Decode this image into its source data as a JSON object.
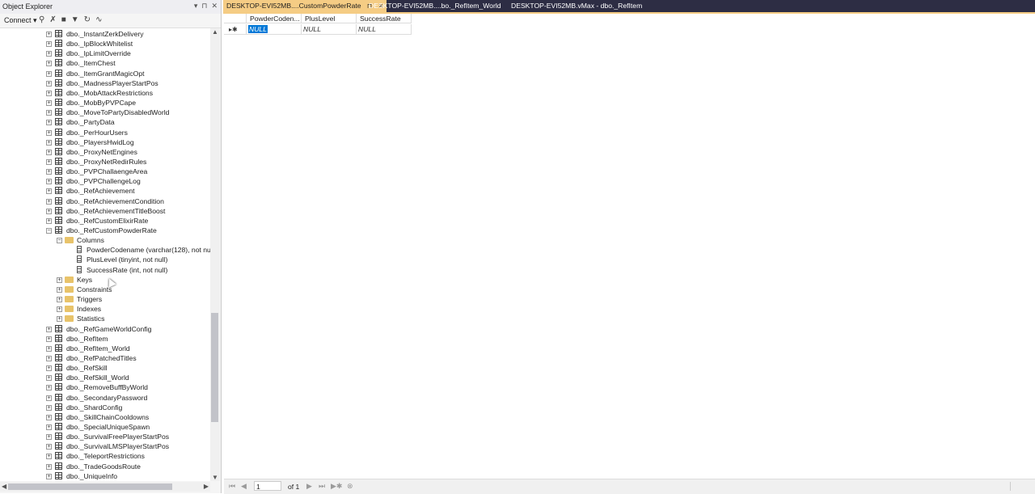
{
  "object_explorer": {
    "title": "Object Explorer",
    "controls": [
      "▾",
      "⊓",
      "✕"
    ],
    "toolbar": {
      "connect_label": "Connect ▾"
    },
    "tree": [
      {
        "label": "dbo._InstantZerkDelivery",
        "type": "table",
        "expand": "+"
      },
      {
        "label": "dbo._IpBlockWhitelist",
        "type": "table",
        "expand": "+"
      },
      {
        "label": "dbo._IpLimitOverride",
        "type": "table",
        "expand": "+"
      },
      {
        "label": "dbo._ItemChest",
        "type": "table",
        "expand": "+"
      },
      {
        "label": "dbo._ItemGrantMagicOpt",
        "type": "table",
        "expand": "+"
      },
      {
        "label": "dbo._MadnessPlayerStartPos",
        "type": "table",
        "expand": "+"
      },
      {
        "label": "dbo._MobAttackRestrictions",
        "type": "table",
        "expand": "+"
      },
      {
        "label": "dbo._MobByPVPCape",
        "type": "table",
        "expand": "+"
      },
      {
        "label": "dbo._MoveToPartyDisabledWorld",
        "type": "table",
        "expand": "+"
      },
      {
        "label": "dbo._PartyData",
        "type": "table",
        "expand": "+"
      },
      {
        "label": "dbo._PerHourUsers",
        "type": "table",
        "expand": "+"
      },
      {
        "label": "dbo._PlayersHwidLog",
        "type": "table",
        "expand": "+"
      },
      {
        "label": "dbo._ProxyNetEngines",
        "type": "table",
        "expand": "+"
      },
      {
        "label": "dbo._ProxyNetRedirRules",
        "type": "table",
        "expand": "+"
      },
      {
        "label": "dbo._PVPChallaengeArea",
        "type": "table",
        "expand": "+"
      },
      {
        "label": "dbo._PVPChallengeLog",
        "type": "table",
        "expand": "+"
      },
      {
        "label": "dbo._RefAchievement",
        "type": "table",
        "expand": "+"
      },
      {
        "label": "dbo._RefAchievementCondition",
        "type": "table",
        "expand": "+"
      },
      {
        "label": "dbo._RefAchievementTitleBoost",
        "type": "table",
        "expand": "+"
      },
      {
        "label": "dbo._RefCustomElixirRate",
        "type": "table",
        "expand": "+"
      },
      {
        "label": "dbo._RefCustomPowderRate",
        "type": "table",
        "expand": "−"
      },
      {
        "label": "Columns",
        "type": "folder",
        "expand": "−",
        "level": 1
      },
      {
        "label": "PowderCodename (varchar(128), not null)",
        "type": "column",
        "level": 2
      },
      {
        "label": "PlusLevel (tinyint, not null)",
        "type": "column",
        "level": 2
      },
      {
        "label": "SuccessRate (int, not null)",
        "type": "column",
        "level": 2
      },
      {
        "label": "Keys",
        "type": "folder",
        "expand": "+",
        "level": 1
      },
      {
        "label": "Constraints",
        "type": "folder",
        "expand": "+",
        "level": 1
      },
      {
        "label": "Triggers",
        "type": "folder",
        "expand": "+",
        "level": 1
      },
      {
        "label": "Indexes",
        "type": "folder",
        "expand": "+",
        "level": 1
      },
      {
        "label": "Statistics",
        "type": "folder",
        "expand": "+",
        "level": 1
      },
      {
        "label": "dbo._RefGameWorldConfig",
        "type": "table",
        "expand": "+"
      },
      {
        "label": "dbo._RefItem",
        "type": "table",
        "expand": "+"
      },
      {
        "label": "dbo._RefItem_World",
        "type": "table",
        "expand": "+"
      },
      {
        "label": "dbo._RefPatchedTitles",
        "type": "table",
        "expand": "+"
      },
      {
        "label": "dbo._RefSkill",
        "type": "table",
        "expand": "+"
      },
      {
        "label": "dbo._RefSkill_World",
        "type": "table",
        "expand": "+"
      },
      {
        "label": "dbo._RemoveBuffByWorld",
        "type": "table",
        "expand": "+"
      },
      {
        "label": "dbo._SecondaryPassword",
        "type": "table",
        "expand": "+"
      },
      {
        "label": "dbo._ShardConfig",
        "type": "table",
        "expand": "+"
      },
      {
        "label": "dbo._SkillChainCooldowns",
        "type": "table",
        "expand": "+"
      },
      {
        "label": "dbo._SpecialUniqueSpawn",
        "type": "table",
        "expand": "+"
      },
      {
        "label": "dbo._SurvivalFreePlayerStartPos",
        "type": "table",
        "expand": "+"
      },
      {
        "label": "dbo._SurvivalLMSPlayerStartPos",
        "type": "table",
        "expand": "+"
      },
      {
        "label": "dbo._TeleportRestrictions",
        "type": "table",
        "expand": "+"
      },
      {
        "label": "dbo._TradeGoodsRoute",
        "type": "table",
        "expand": "+"
      },
      {
        "label": "dbo._UniqueInfo",
        "type": "table",
        "expand": "+"
      }
    ]
  },
  "tabs": [
    {
      "label": "DESKTOP-EVI52MB....CustomPowderRate",
      "active": true,
      "pin": "⊓",
      "close": "✕"
    },
    {
      "label": "DESKTOP-EVI52MB....bo._RefItem_World",
      "active": false
    },
    {
      "label": "DESKTOP-EVI52MB.vMax - dbo._RefItem",
      "active": false
    }
  ],
  "grid": {
    "columns": [
      "PowderCoden...",
      "PlusLevel",
      "SuccessRate"
    ],
    "row_marker": "▸✱",
    "rows": [
      [
        "NULL",
        "NULL",
        "NULL"
      ]
    ]
  },
  "nav": {
    "page": "1",
    "of_label": "of 1"
  }
}
